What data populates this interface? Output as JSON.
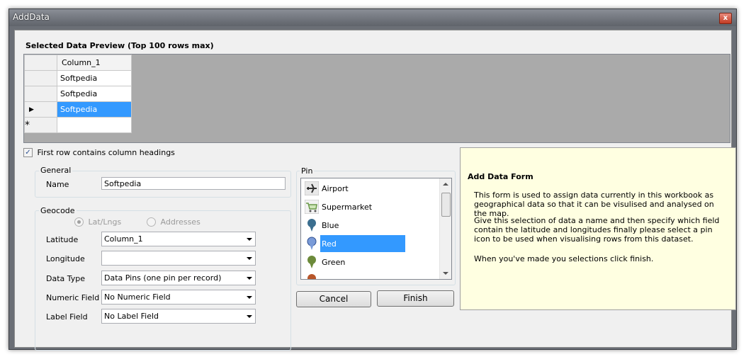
{
  "window": {
    "title": "AddData",
    "close_glyph": "x"
  },
  "preview": {
    "heading": "Selected Data Preview (Top 100 rows max)",
    "column_header": "Column_1",
    "rows": [
      "Softpedia",
      "Softpedia",
      "Softpedia",
      ""
    ],
    "selected_row_index": 2,
    "new_row_marker": "*",
    "current_row_marker": "▶"
  },
  "first_row_headings": {
    "label": "First row contains column headings",
    "checked": true
  },
  "general": {
    "group_title": "General",
    "name_label": "Name",
    "name_value": "Softpedia"
  },
  "geocode": {
    "group_title": "Geocode",
    "radio_latlng": "Lat/Lngs",
    "radio_addresses": "Addresses",
    "latitude_label": "Latitude",
    "latitude_value": "Column_1",
    "longitude_label": "Longitude",
    "longitude_value": "",
    "data_type_label": "Data Type",
    "data_type_value": "Data Pins (one pin per record)",
    "numeric_field_label": "Numeric Field",
    "numeric_field_value": "No Numeric Field",
    "label_field_label": "Label Field",
    "label_field_value": "No Label Field"
  },
  "pin": {
    "group_title": "Pin",
    "items": [
      {
        "label": "Airport",
        "icon": "airplane-icon"
      },
      {
        "label": "Supermarket",
        "icon": "shopping-cart-icon"
      },
      {
        "label": "Blue",
        "icon": "blue-pin-icon",
        "color": "#3b6e8f"
      },
      {
        "label": "Red",
        "icon": "red-pin-icon",
        "color": "#7a9bd8"
      },
      {
        "label": "Green",
        "icon": "green-pin-icon",
        "color": "#6c8a3a"
      }
    ],
    "selected_index": 3
  },
  "buttons": {
    "cancel": "Cancel",
    "finish": "Finish"
  },
  "help": {
    "title": "Add Data Form",
    "p1": "This form is used to assign data currently in this workbook as geographical data so that it can be visulised and analysed on the map.",
    "p2": "Give this selection of data a name and then specify which field contain the latitude and longitudes finally please select a pin icon to be used when visualising rows from this dataset.",
    "p3": "When you've made you selections click finish."
  },
  "colors": {
    "selection": "#3399ff",
    "help_bg": "#ffffe1",
    "grid_bg": "#aaaaaa"
  }
}
